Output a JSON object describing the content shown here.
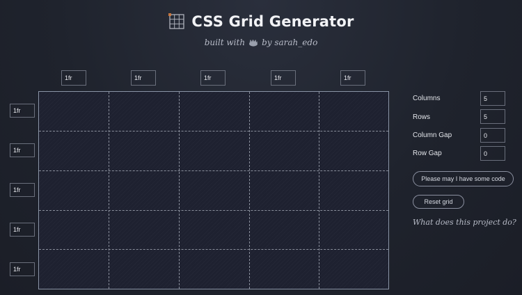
{
  "header": {
    "title": "CSS Grid Generator",
    "byline_prefix": "built with",
    "byline_suffix": "by sarah_edo",
    "logo_icon": "grid-logo-icon",
    "byline_icon": "hedgehog-icon"
  },
  "columns": [
    {
      "value": "1fr"
    },
    {
      "value": "1fr"
    },
    {
      "value": "1fr"
    },
    {
      "value": "1fr"
    },
    {
      "value": "1fr"
    }
  ],
  "rows": [
    {
      "value": "1fr"
    },
    {
      "value": "1fr"
    },
    {
      "value": "1fr"
    },
    {
      "value": "1fr"
    },
    {
      "value": "1fr"
    }
  ],
  "controls": {
    "columns_label": "Columns",
    "columns_value": "5",
    "rows_label": "Rows",
    "rows_value": "5",
    "column_gap_label": "Column Gap",
    "column_gap_value": "0",
    "row_gap_label": "Row Gap",
    "row_gap_value": "0"
  },
  "actions": {
    "code_button": "Please may I have some code",
    "reset_button": "Reset grid",
    "about_link": "What does this project do?"
  },
  "colors": {
    "background": "#1f232d",
    "grid_background": "#1e2130",
    "border": "#8a94a6"
  }
}
